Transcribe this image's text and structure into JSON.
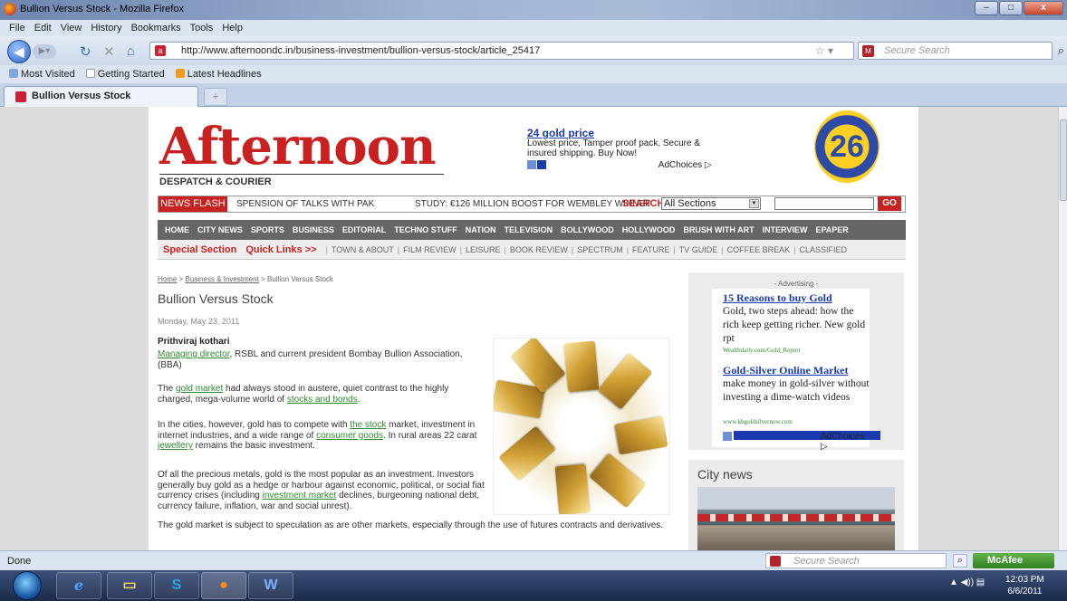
{
  "window": {
    "title": "Bullion Versus Stock - Mozilla Firefox",
    "min": "–",
    "max": "□",
    "close": "x"
  },
  "menu": [
    "File",
    "Edit",
    "View",
    "History",
    "Bookmarks",
    "Tools",
    "Help"
  ],
  "nav": {
    "url": "http://www.afternoondc.in/business-investment/bullion-versus-stock/article_25417",
    "search_placeholder": "Secure Search"
  },
  "bookmarks": [
    "Most Visited",
    "Getting Started",
    "Latest Headlines"
  ],
  "tab": {
    "label": "Bullion Versus Stock",
    "new": "+"
  },
  "header": {
    "logo": "Afternoon",
    "logo_sub": "DESPATCH & COURIER",
    "ad_title": "24 gold price",
    "ad_text": "Lowest price, Tamper proof pack, Secure & insured shipping. Buy Now!",
    "ad_choices": "AdChoices ▷",
    "badge": "26"
  },
  "newsbar": {
    "flash": "NEWS FLASH",
    "ticker1": "SPENSION OF TALKS WITH PAK",
    "ticker2": "STUDY: €126 MILLION BOOST FOR WEMBLEY WINNEF",
    "search_label": "SEARCH",
    "search_select": "All Sections",
    "go": "GO"
  },
  "mainnav": [
    "HOME",
    "CITY NEWS",
    "SPORTS",
    "BUSINESS",
    "EDITORIAL",
    "TECHNO STUFF",
    "NATION",
    "TELEVISION",
    "BOLLYWOOD",
    "HOLLYWOOD",
    "BRUSH WITH ART",
    "INTERVIEW",
    "EPAPER"
  ],
  "subnav": {
    "special": "Special Section",
    "quick": "Quick Links >>",
    "items": [
      "TOWN & ABOUT",
      "FILM REVIEW",
      "LEISURE",
      "BOOK REVIEW",
      "SPECTRUM",
      "FEATURE",
      "TV GUIDE",
      "COFFEE BREAK",
      "CLASSIFIED"
    ]
  },
  "article": {
    "crumb_home": "Home",
    "crumb_section": "Business & Investment",
    "crumb_current": "Bullion Versus Stock",
    "crumb_sep": ">",
    "title": "Bullion Versus Stock",
    "date": "Monday, May 23, 2011",
    "author": "Prithviraj kothari",
    "p1_link": "Managing director",
    "p1_text": ", RSBL and current president Bombay Bullion Association, (BBA)",
    "p2_a": "The ",
    "p2_link1": "gold market",
    "p2_b": " had always stood in austere, quiet contrast to the highly charged, mega-volume world of ",
    "p2_link2": "stocks and bonds",
    "p2_c": ".",
    "p3_a": "In the cities, however, gold has to compete with ",
    "p3_link1": "the stock",
    "p3_b": " market, investment in internet industries, and a wide range of ",
    "p3_link2": "consumer goods",
    "p3_c": ". In rural areas 22 carat ",
    "p3_link3": "jewellery",
    "p3_d": " remains the basic investment.",
    "p4_a": "Of all the precious metals, gold is the most popular as an investment. Investors generally buy gold as a hedge or harbour against economic, political, or social fiat currency crises (including ",
    "p4_link": "investment market",
    "p4_b": " declines, burgeoning national debt, currency failure, inflation, war and social unrest).",
    "p5": "The gold market is subject to speculation as are other markets, especially through the use of futures contracts and derivatives."
  },
  "sidebar": {
    "adv_label": "- Advertising -",
    "ad1_title": "15 Reasons to buy Gold",
    "ad1_text": "Gold, two steps ahead: how the rich keep getting richer. New gold rpt",
    "ad1_src": "Wealthdaily.com/Gold_Report",
    "ad2_title": "Gold-Silver Online Market",
    "ad2_text": "make money in gold-silver without investing a dime-watch videos",
    "ad2_src": "www.kbgoldsilvernow.com",
    "ad_choices": "AdChoices ▷",
    "city_news": "City news"
  },
  "status": {
    "done": "Done",
    "search_placeholder": "Secure Search",
    "mcafee": "McAfee"
  },
  "taskbar": {
    "time": "12:03 PM",
    "date": "6/6/2011"
  }
}
